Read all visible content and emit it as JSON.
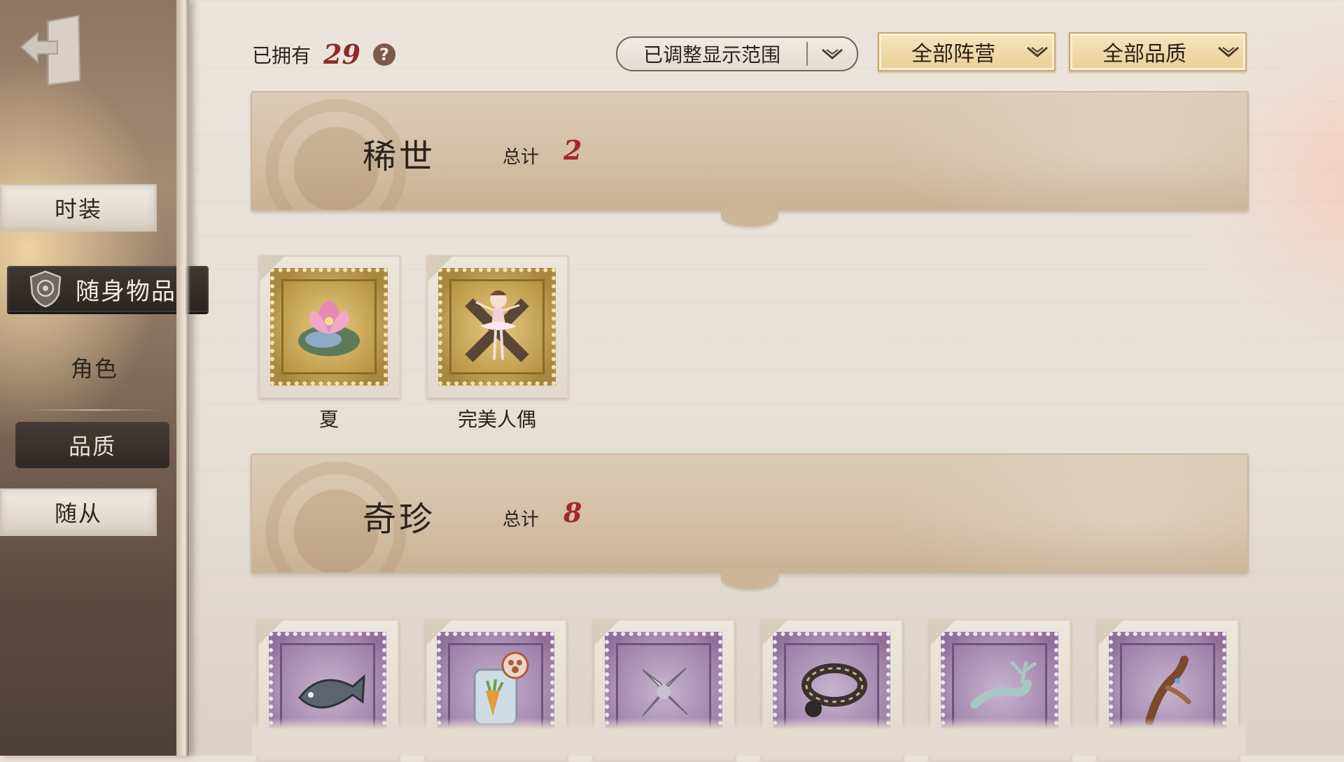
{
  "sidebar": {
    "back_icon": "exit-door-icon",
    "items": [
      {
        "label": "时装"
      },
      {
        "label": "随身物品",
        "icon": "shield-emblem-icon"
      },
      {
        "label": "角色"
      },
      {
        "label": "品质"
      },
      {
        "label": "随从"
      }
    ]
  },
  "topbar": {
    "owned_label": "已拥有",
    "owned_count": "29",
    "help_icon": "?",
    "range_dropdown": "已调整显示范围",
    "camp_dropdown": "全部阵营",
    "quality_dropdown": "全部品质"
  },
  "sections": [
    {
      "title": "稀世",
      "total_label": "总计",
      "total": "2",
      "items": [
        {
          "name": "夏",
          "icon": "lotus-icon"
        },
        {
          "name": "完美人偶",
          "icon": "ballerina-doll-icon"
        }
      ]
    },
    {
      "title": "奇珍",
      "total_label": "总计",
      "total": "8",
      "items": [
        {
          "name": "",
          "icon": "fish-icon"
        },
        {
          "name": "",
          "icon": "carrot-jar-icon"
        },
        {
          "name": "",
          "icon": "white-flower-icon"
        },
        {
          "name": "",
          "icon": "bracelet-icon"
        },
        {
          "name": "",
          "icon": "antler-dragon-icon"
        },
        {
          "name": "",
          "icon": "wooden-flute-icon"
        }
      ]
    }
  ],
  "colors": {
    "accent_red": "#a4282a",
    "rare_gold": "#c9a85e",
    "epic_purple": "#9a7da6"
  }
}
